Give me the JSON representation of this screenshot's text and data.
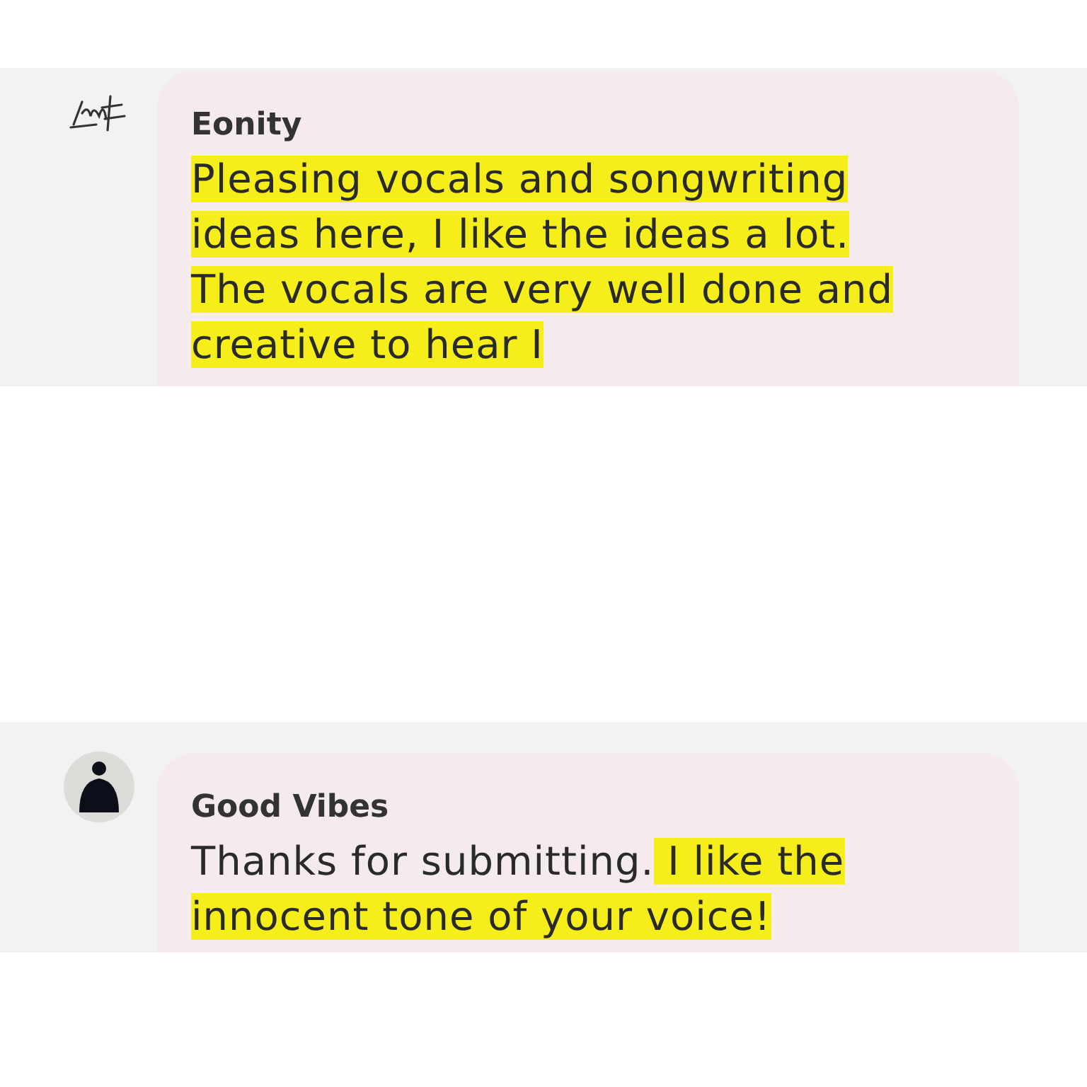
{
  "comments": [
    {
      "author": "Eonity",
      "kind": "signature",
      "lines": [
        [
          {
            "text": "Pleasing vocals and songwriting",
            "highlighted": true
          }
        ],
        [
          {
            "text": "ideas here, I like the ideas a lot.",
            "highlighted": true
          }
        ],
        [
          {
            "text": "The vocals are very well done and",
            "highlighted": true
          }
        ],
        [
          {
            "text": "creative to hear I",
            "highlighted": true
          }
        ]
      ]
    },
    {
      "author": "Good Vibes",
      "kind": "silhouette",
      "lines": [
        [
          {
            "text": "Thanks for submitting.",
            "highlighted": false
          },
          {
            "text": " I like the",
            "highlighted": true
          }
        ],
        [
          {
            "text": "innocent tone of your voice!",
            "highlighted": true
          }
        ]
      ]
    }
  ]
}
